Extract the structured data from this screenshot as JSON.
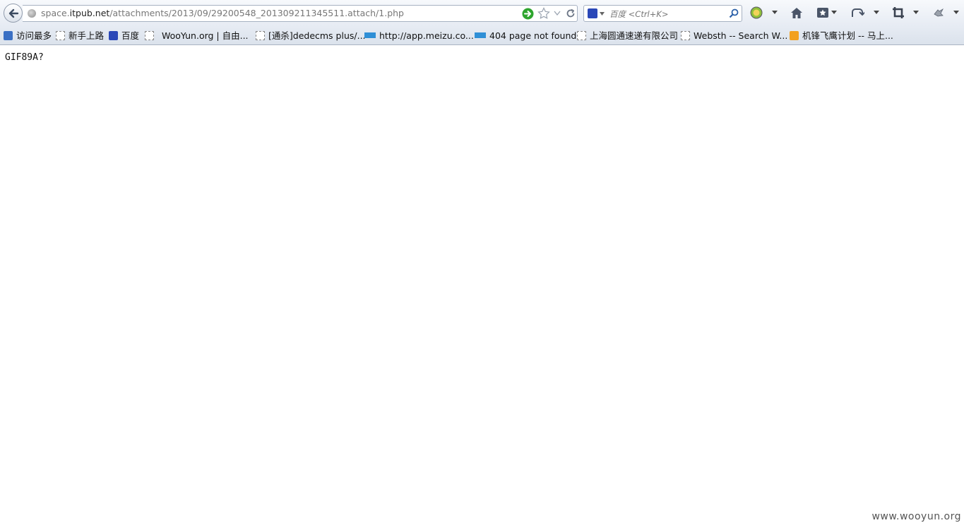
{
  "browser": {
    "url": {
      "prefix": "space.",
      "domain": "itpub.net",
      "path": "/attachments/2013/09/29200548_201309211345511.attach/1.php"
    },
    "search": {
      "placeholder": "百度 <Ctrl+K>"
    }
  },
  "bookmarks": [
    {
      "label": "访问最多",
      "icon": "most-visited-icon"
    },
    {
      "label": "新手上路",
      "icon": "page-icon"
    },
    {
      "label": "百度",
      "icon": "baidu-paw-icon"
    },
    {
      "label": "WooYun.org | 自由...",
      "icon": "page-icon"
    },
    {
      "label": "[通杀]dedecms plus/...",
      "icon": "page-icon"
    },
    {
      "label": "http://app.meizu.co...",
      "icon": "meizu-icon"
    },
    {
      "label": "404 page not found",
      "icon": "meizu-icon"
    },
    {
      "label": "上海圆通速递有限公司",
      "icon": "page-icon"
    },
    {
      "label": "Websth -- Search W...",
      "icon": "page-icon"
    },
    {
      "label": "机锋飞鹰计划 -- 马上...",
      "icon": "rss-icon"
    }
  ],
  "page": {
    "body_text": "GIF89A?"
  },
  "watermark": "www.wooyun.org"
}
